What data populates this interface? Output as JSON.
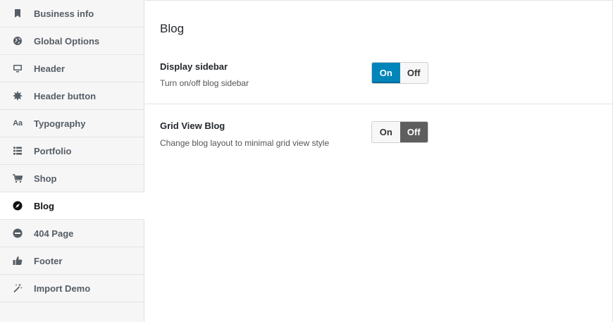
{
  "sidebar": {
    "items": [
      {
        "label": "Business info",
        "icon": "bookmark-icon"
      },
      {
        "label": "Global Options",
        "icon": "globe-icon"
      },
      {
        "label": "Header",
        "icon": "monitor-icon"
      },
      {
        "label": "Header button",
        "icon": "starburst-icon"
      },
      {
        "label": "Typography",
        "icon": "typography-icon",
        "glyph": "Aa"
      },
      {
        "label": "Portfolio",
        "icon": "list-icon"
      },
      {
        "label": "Shop",
        "icon": "cart-icon"
      },
      {
        "label": "Blog",
        "icon": "compass-icon"
      },
      {
        "label": "404 Page",
        "icon": "minus-circle-icon"
      },
      {
        "label": "Footer",
        "icon": "thumbs-up-icon"
      },
      {
        "label": "Import Demo",
        "icon": "magic-wand-icon"
      }
    ],
    "active": "Blog"
  },
  "main": {
    "title": "Blog",
    "options": [
      {
        "title": "Display sidebar",
        "description": "Turn on/off blog sidebar",
        "on_label": "On",
        "off_label": "Off",
        "value": "On"
      },
      {
        "title": "Grid View Blog",
        "description": "Change blog layout to minimal grid view style",
        "on_label": "On",
        "off_label": "Off",
        "value": "Off"
      }
    ]
  },
  "colors": {
    "toggle_on_active": "#0085ba",
    "toggle_off_active": "#5e5e5e",
    "sidebar_bg": "#f6f6f6"
  }
}
